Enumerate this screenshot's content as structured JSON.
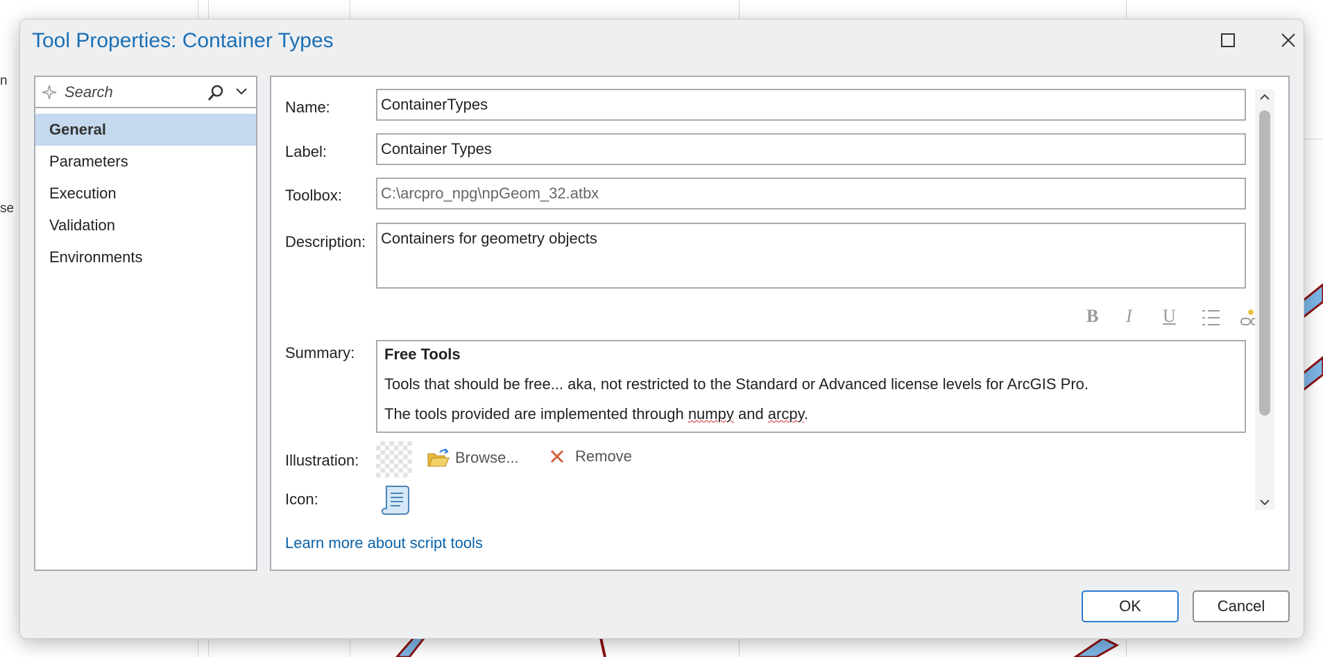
{
  "background": {
    "fragment_1": "n",
    "fragment_2": "se"
  },
  "dialog": {
    "title": "Tool Properties: Container Types",
    "search": {
      "placeholder": "Search"
    },
    "nav": [
      {
        "label": "General",
        "selected": true
      },
      {
        "label": "Parameters",
        "selected": false
      },
      {
        "label": "Execution",
        "selected": false
      },
      {
        "label": "Validation",
        "selected": false
      },
      {
        "label": "Environments",
        "selected": false
      }
    ],
    "general": {
      "name_label": "Name:",
      "name_value": "ContainerTypes",
      "label_label": "Label:",
      "label_value": "Container Types",
      "toolbox_label": "Toolbox:",
      "toolbox_value": "C:\\arcpro_npg\\npGeom_32.atbx",
      "description_label": "Description:",
      "description_value": "Containers for geometry objects",
      "format_toolbar": {
        "bold": "B",
        "italic": "I",
        "underline": "U"
      },
      "summary_label": "Summary:",
      "summary_heading": "Free Tools",
      "summary_line_1": "Tools that should be free... aka, not restricted to the Standard or Advanced license levels for ArcGIS Pro.",
      "summary_line_2_pre": "The tools provided are implemented through ",
      "summary_word_1": "numpy",
      "summary_line_2_mid": " and ",
      "summary_word_2": "arcpy",
      "summary_line_2_post": ".",
      "illustration_label": "Illustration:",
      "browse_label": "Browse...",
      "remove_label": "Remove",
      "icon_label": "Icon:",
      "learn_more": "Learn more about script tools"
    },
    "buttons": {
      "ok": "OK",
      "cancel": "Cancel"
    },
    "colors": {
      "accent": "#1a6fb5",
      "selection": "#c4d9ee",
      "link": "#0b62a8",
      "remove_x": "#d0603a"
    }
  }
}
